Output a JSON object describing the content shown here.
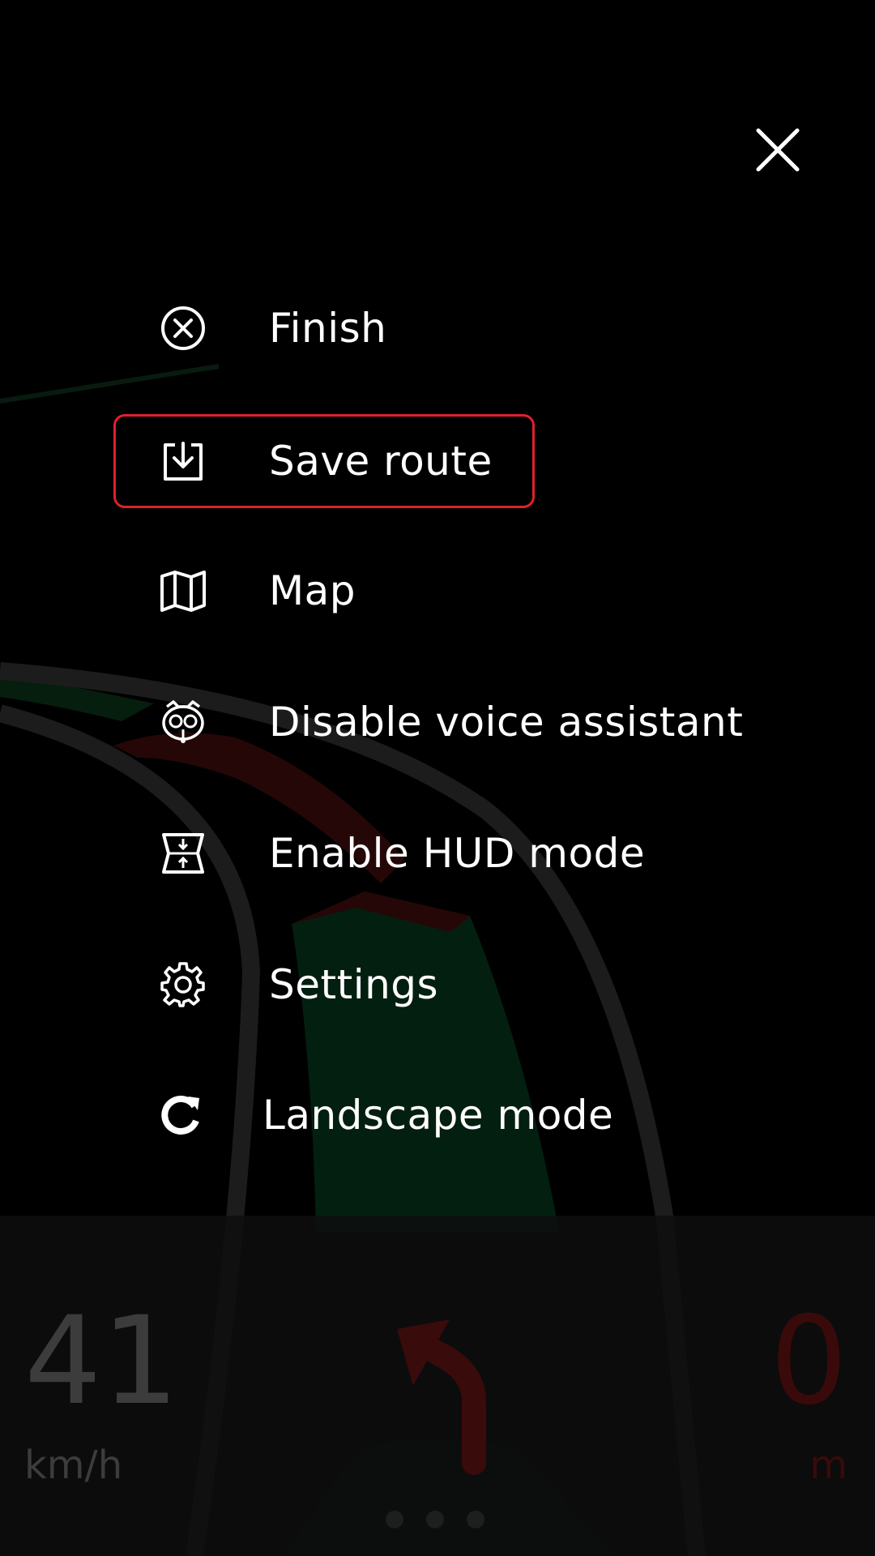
{
  "close": {
    "icon": "close-icon"
  },
  "menu": {
    "items": [
      {
        "label": "Finish",
        "icon": "cancel-circle-icon"
      },
      {
        "label": "Save route",
        "icon": "download-tray-icon",
        "highlighted": true
      },
      {
        "label": "Map",
        "icon": "map-icon"
      },
      {
        "label": "Disable voice assistant",
        "icon": "owl-assistant-icon"
      },
      {
        "label": "Enable HUD mode",
        "icon": "hud-icon"
      },
      {
        "label": "Settings",
        "icon": "gear-icon"
      },
      {
        "label": "Landscape mode",
        "icon": "rotate-icon"
      }
    ]
  },
  "dashboard": {
    "speed": "41",
    "speed_unit": "km/h",
    "distance": "0",
    "distance_unit": "m",
    "turn_icon": "turn-left-arrow-icon"
  },
  "colors": {
    "highlight_border": "#e0202b",
    "road_red": "#3a0b0b",
    "road_green": "#06301a"
  }
}
